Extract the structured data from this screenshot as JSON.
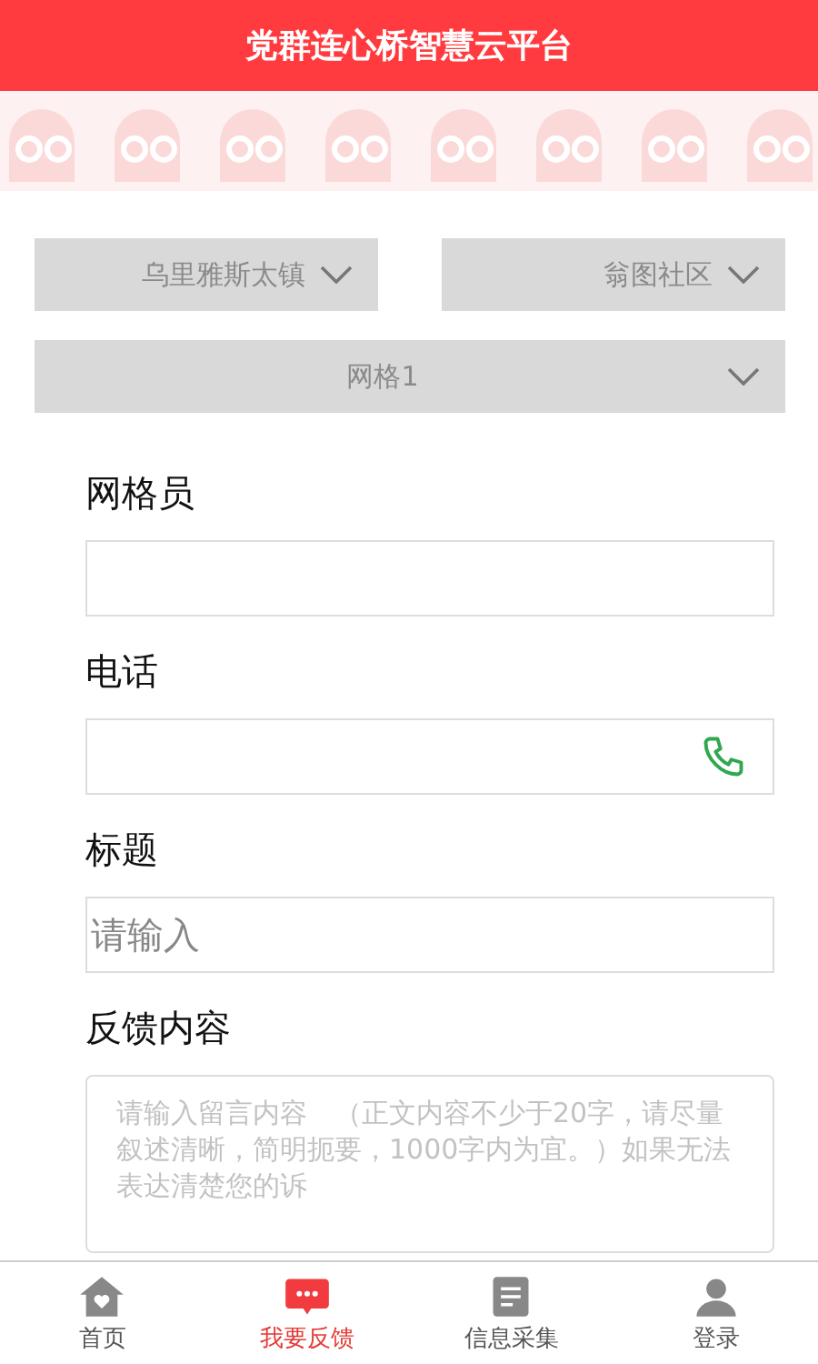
{
  "header": {
    "title": "党群连心桥智慧云平台"
  },
  "selects": [
    {
      "value": "乌里雅斯太镇",
      "kind": "half"
    },
    {
      "value": "翁图社区",
      "kind": "half"
    },
    {
      "value": "网格1",
      "kind": "full"
    }
  ],
  "fields": [
    {
      "label": "网格员",
      "kind": "input"
    },
    {
      "label": "电话",
      "kind": "phone"
    },
    {
      "label": "标题",
      "kind": "input",
      "placeholder": "请输入"
    },
    {
      "label": "反馈内容",
      "kind": "textarea",
      "placeholder": "请输入留言内容　（正文内容不少于20字，请尽量叙述清晰，简明扼要，1000字内为宜。）如果无法表达清楚您的诉"
    }
  ],
  "tabs": [
    {
      "label": "首页",
      "selected": false
    },
    {
      "label": "我要反馈",
      "selected": true
    },
    {
      "label": "信息采集",
      "selected": false
    },
    {
      "label": "登录",
      "selected": false
    }
  ]
}
